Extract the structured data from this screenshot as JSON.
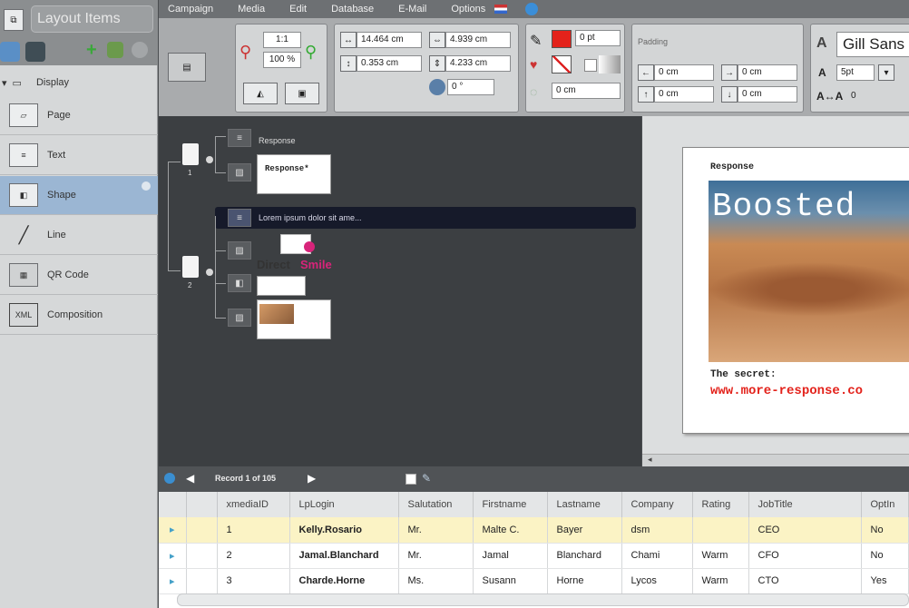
{
  "left_panel": {
    "title": "Layout Items",
    "section": "Display",
    "items": [
      {
        "label": "Page",
        "icon": "page-icon"
      },
      {
        "label": "Text",
        "icon": "text-icon"
      },
      {
        "label": "Shape",
        "icon": "shape-icon"
      },
      {
        "label": "Line",
        "icon": "line-icon"
      },
      {
        "label": "QR Code",
        "icon": "qr-code-icon"
      },
      {
        "label": "Composition",
        "icon": "xml-icon",
        "icon_text": "XML"
      }
    ]
  },
  "menu": [
    "Campaign",
    "Media",
    "Edit",
    "Database",
    "E-Mail",
    "Options"
  ],
  "ribbon": {
    "zoom_ratio": "1:1",
    "zoom_percent": "100 %",
    "x": "14.464 cm",
    "width": "4.939 cm",
    "y": "0.353 cm",
    "height": "4.233 cm",
    "rotation": "0 °",
    "stroke_width": "0 pt",
    "corner": "0 cm",
    "padding_label": "Padding",
    "pad_left": "0 cm",
    "pad_right": "0 cm",
    "pad_top": "0 cm",
    "pad_bottom": "0 cm",
    "font_name": "Gill Sans",
    "font_size": "5pt",
    "tracking": "0",
    "accent": "#e3221b"
  },
  "tree": {
    "page1_number": "1",
    "page2_number": "2",
    "response_label": "Response",
    "response_thumb": "Response*",
    "selected_text": "Lorem ipsum dolor sit ame...",
    "logo_direct": "Direct",
    "logo_smile": "Smile"
  },
  "preview": {
    "header": "Response",
    "headline": "Boosted",
    "secret": "The secret:",
    "url": "www.more-response.co"
  },
  "record_bar": {
    "text": "Record 1 of 105"
  },
  "grid": {
    "columns": [
      "xmediaID",
      "LpLogin",
      "Salutation",
      "Firstname",
      "Lastname",
      "Company",
      "Rating",
      "JobTitle",
      "OptIn"
    ],
    "rows": [
      [
        "1",
        "Kelly.Rosario",
        "Mr.",
        "Malte C.",
        "Bayer",
        "dsm",
        "",
        "CEO",
        "No"
      ],
      [
        "2",
        "Jamal.Blanchard",
        "Mr.",
        "Jamal",
        "Blanchard",
        "Chami",
        "Warm",
        "CFO",
        "No"
      ],
      [
        "3",
        "Charde.Horne",
        "Ms.",
        "Susann",
        "Horne",
        "Lycos",
        "Warm",
        "CTO",
        "Yes"
      ]
    ]
  }
}
